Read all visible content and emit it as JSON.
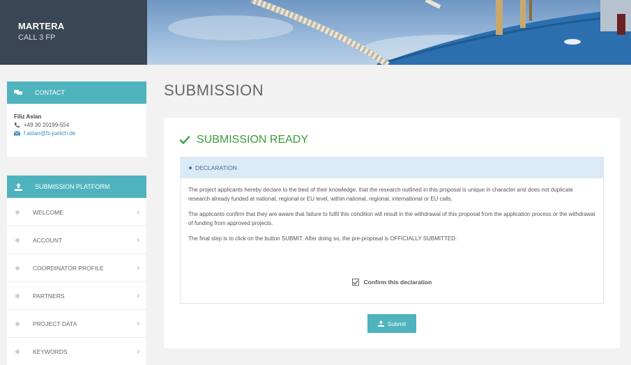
{
  "header": {
    "brand_title": "MARTERA",
    "brand_subtitle": "CALL 3 FP"
  },
  "contact": {
    "heading": "CONTACT",
    "name": "Filiz Aslan",
    "phone": "+49 30 20199-554",
    "email": "f.aslan@fz-juelich.de"
  },
  "nav": {
    "heading": "SUBMISSION PLATFORM",
    "items": [
      {
        "label": "WELCOME"
      },
      {
        "label": "ACCOUNT"
      },
      {
        "label": "COORDINATOR PROFILE"
      },
      {
        "label": "PARTNERS"
      },
      {
        "label": "PROJECT DATA"
      },
      {
        "label": "KEYWORDS"
      }
    ],
    "chevron": "›"
  },
  "main": {
    "page_title": "SUBMISSION",
    "status": "SUBMISSION READY",
    "declaration_heading": "DECLARATION",
    "paragraphs": [
      "The project applicants hereby declare to the best of their knowledge, that the research outlined in this proposal is unique in character and does not duplicate research already funded at national, regional or EU level, within national, regional, international or EU calls.",
      "The applicants confirm that they are aware that failure to fulfil this condition will result in the withdrawal of this proposal from the application process or the withdrawal of funding from approved projects.",
      "The final step is to click on the button SUBMIT. After doing so, the pre-proposal is OFFICIALLY SUBMITTED."
    ],
    "confirm_label": "Confirm this declaration",
    "submit_label": "Submit"
  },
  "colors": {
    "accent": "#4fb3bd",
    "brand_bg": "#3a4654",
    "success": "#3a9b3a",
    "declaration_bg": "#daeaf6"
  },
  "icons": {
    "contact": "chat-bubbles-icon",
    "phone": "phone-icon",
    "email": "envelope-icon",
    "submission": "upload-icon",
    "status": "checkmark-icon",
    "confirm": "checkbox-checked-icon",
    "submit": "upload-icon"
  }
}
